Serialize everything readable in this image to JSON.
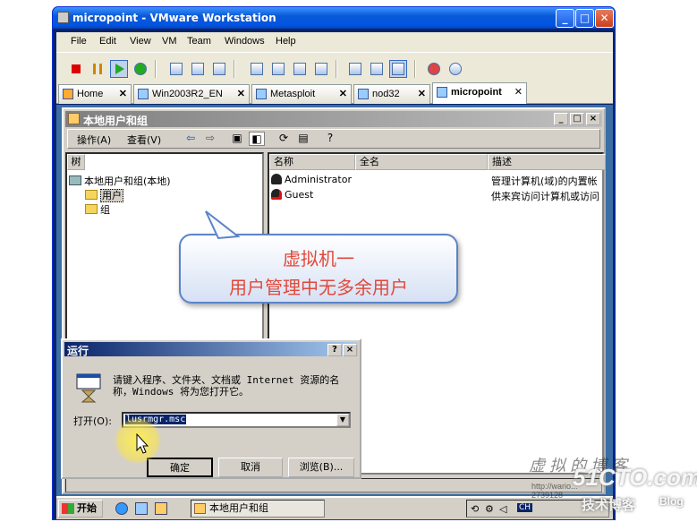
{
  "vmware": {
    "title": "micropoint - VMware Workstation",
    "menu": [
      "File",
      "Edit",
      "View",
      "VM",
      "Team",
      "Windows",
      "Help"
    ],
    "tabs": [
      {
        "label": "Home",
        "active": false
      },
      {
        "label": "Win2003R2_EN",
        "active": false
      },
      {
        "label": "Metasploit",
        "active": false
      },
      {
        "label": "nod32",
        "active": false
      },
      {
        "label": "micropoint",
        "active": true
      }
    ],
    "close_glyph": "✕"
  },
  "mmc": {
    "title": "本地用户和组",
    "menu": [
      "操作(A)",
      "查看(V)"
    ],
    "tree_header": "树",
    "tree": {
      "root": "本地用户和组(本地)",
      "children": [
        "用户",
        "组"
      ]
    },
    "columns": [
      "名称",
      "全名",
      "描述"
    ],
    "users": [
      {
        "name": "Administrator",
        "full_name": "",
        "description": "管理计算机(域)的内置帐"
      },
      {
        "name": "Guest",
        "full_name": "",
        "description": "供来宾访问计算机或访问"
      }
    ]
  },
  "callout": {
    "line1": "虚拟机一",
    "line2": "用户管理中无多余用户"
  },
  "run_dialog": {
    "title": "运行",
    "help_btn": "?",
    "close_btn": "×",
    "description": "请键入程序、文件夹、文档或 Internet 资源的名称，Windows 将为您打开它。",
    "open_label": "打开(O):",
    "command": "lusrmgr.msc",
    "ok": "确定",
    "cancel": "取消",
    "browse": "浏览(B)..."
  },
  "taskbar": {
    "start": "开始",
    "task": "本地用户和组",
    "lang": "CH"
  },
  "watermark": {
    "line1": "虚拟的博客",
    "site": "51CTO.com",
    "url": "http://wario...",
    "id": "2739128",
    "tech": "技术博客",
    "blog": "Blog"
  }
}
